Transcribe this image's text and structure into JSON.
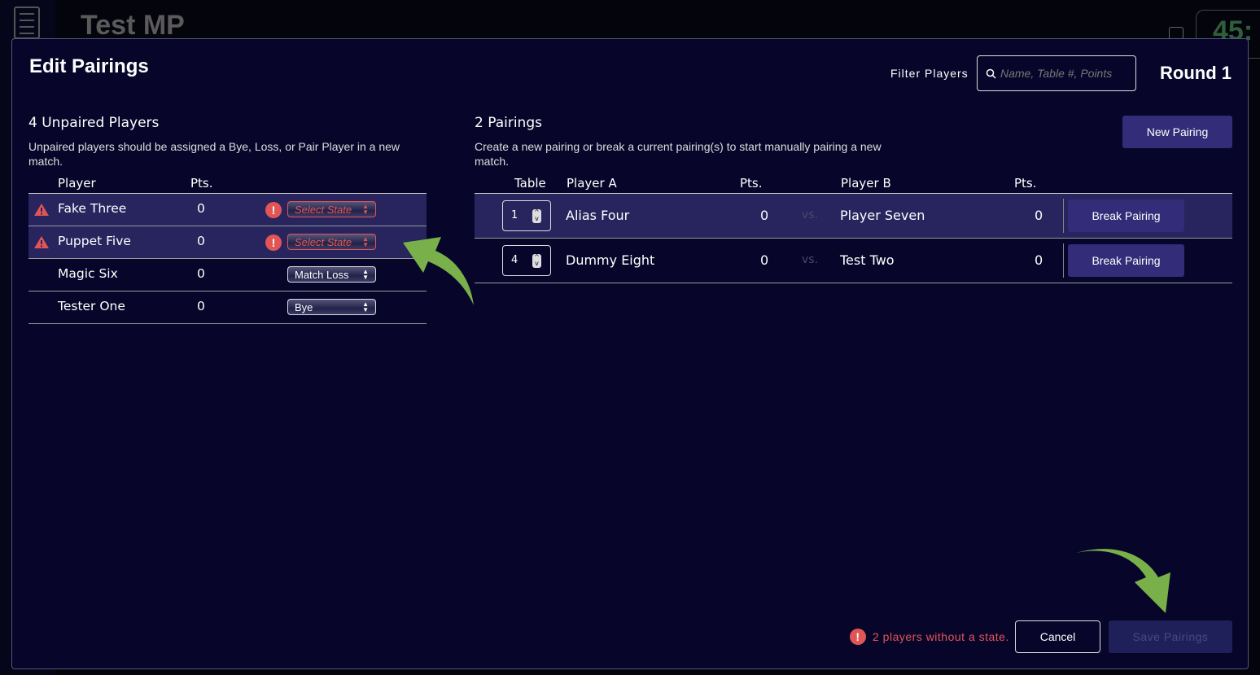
{
  "background": {
    "title": "Test MP",
    "timer": "45:"
  },
  "modal": {
    "title": "Edit Pairings",
    "filter_label": "Filter Players",
    "search_placeholder": "Name, Table #, Points",
    "round": "Round 1",
    "unpaired": {
      "title": "4 Unpaired Players",
      "description": "Unpaired players should be assigned a Bye, Loss, or Pair Player in a new match.",
      "headers": {
        "player": "Player",
        "pts": "Pts."
      },
      "rows": [
        {
          "name": "Fake Three",
          "pts": "0",
          "state": "Select State",
          "warning": true
        },
        {
          "name": "Puppet Five",
          "pts": "0",
          "state": "Select State",
          "warning": true
        },
        {
          "name": "Magic Six",
          "pts": "0",
          "state": "Match Loss",
          "warning": false
        },
        {
          "name": "Tester One",
          "pts": "0",
          "state": "Bye",
          "warning": false
        }
      ]
    },
    "pairings": {
      "title": "2 Pairings",
      "description": "Create a new pairing or break a current pairing(s) to start manually pairing a new match.",
      "new_pairing": "New Pairing",
      "headers": {
        "table": "Table",
        "player_a": "Player A",
        "pts_a": "Pts.",
        "player_b": "Player B",
        "pts_b": "Pts."
      },
      "vs": "vs.",
      "break_label": "Break Pairing",
      "rows": [
        {
          "table": "1",
          "player_a": "Alias Four",
          "pts_a": "0",
          "player_b": "Player Seven",
          "pts_b": "0"
        },
        {
          "table": "4",
          "player_a": "Dummy Eight",
          "pts_a": "0",
          "player_b": "Test Two",
          "pts_b": "0"
        }
      ]
    },
    "footer": {
      "error": "2 players without a state.",
      "cancel": "Cancel",
      "save": "Save Pairings"
    }
  },
  "colors": {
    "modal_bg": "#07062a",
    "highlight_row": "#27245e",
    "button": "#332c78",
    "error": "#e25555",
    "arrow": "#79b04a"
  }
}
